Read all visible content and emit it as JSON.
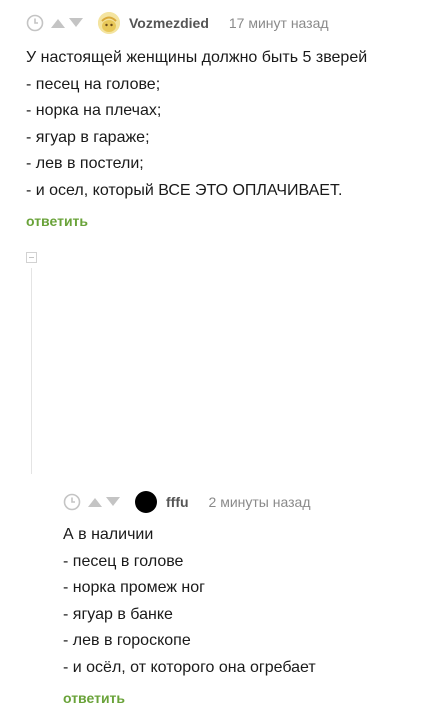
{
  "comments": [
    {
      "author": "Vozmezdied",
      "time": "17 минут назад",
      "avatar_color": "#f4e4a0",
      "lines": [
        "У настоящей женщины должно быть 5 зверей",
        "- песец на голове;",
        "- норка на плечах;",
        "- ягуар в гараже;",
        "- лев в постели;",
        "- и осел, который ВСЕ ЭТО ОПЛАЧИВАЕТ."
      ],
      "reply_label": "ответить"
    },
    {
      "author": "fffu",
      "time": "2 минуты назад",
      "avatar_color": "#000000",
      "lines": [
        "А в наличии",
        "- песец в голове",
        "- норка промеж ног",
        "- ягуар в банке",
        "- лев в гороскопе",
        "- и осёл, от которого она огребает"
      ],
      "reply_label": "ответить"
    }
  ],
  "icons": {
    "time": "clock-icon",
    "upvote": "arrow-up-icon",
    "downvote": "arrow-down-icon",
    "collapse": "collapse-icon"
  },
  "colors": {
    "reply_link": "#6aa33a",
    "meta_text": "#8a8a8a",
    "icon_gray": "#c4c4c4"
  }
}
